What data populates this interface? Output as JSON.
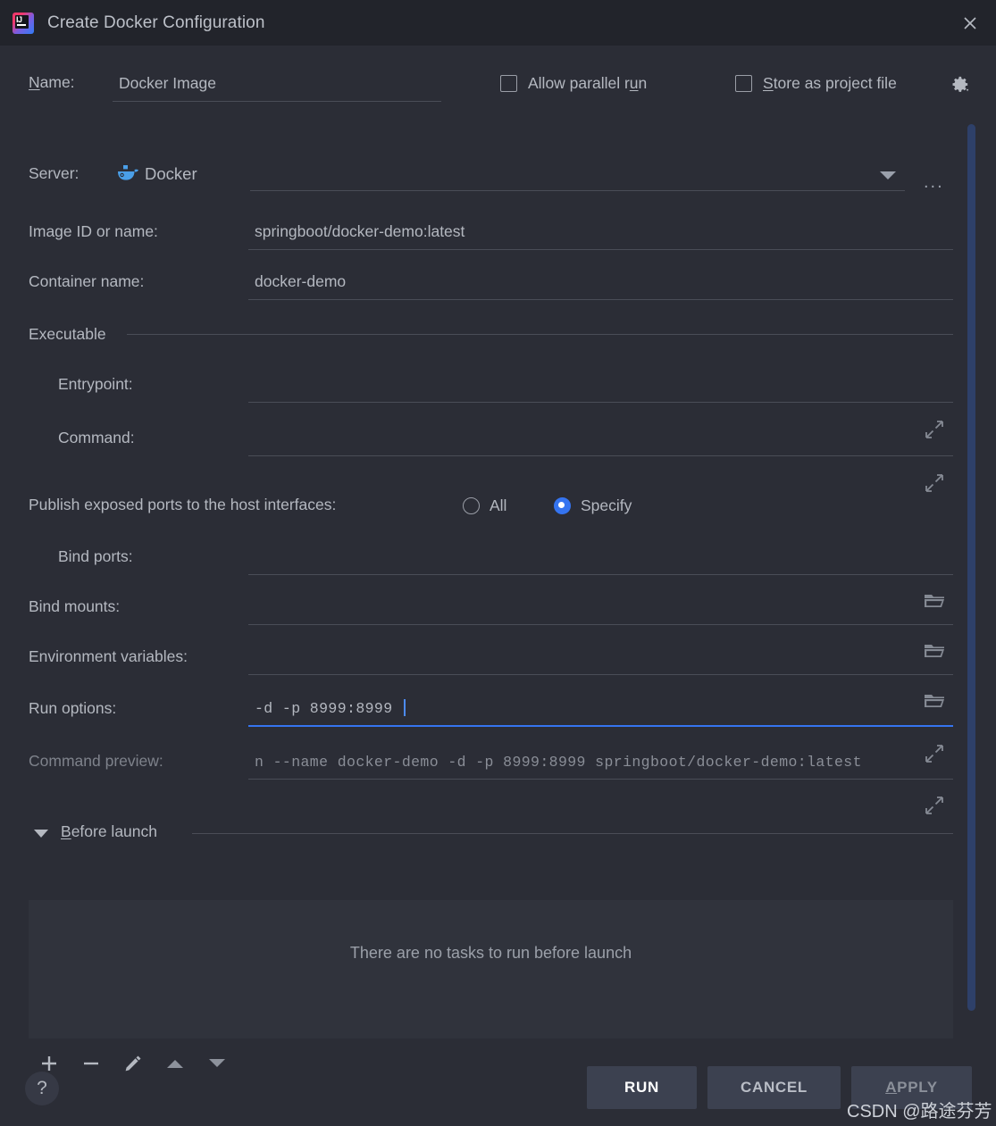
{
  "window": {
    "title": "Create Docker Configuration",
    "logo_icon": "intellij-idea-logo",
    "close_icon": "close-icon"
  },
  "header": {
    "name_label": "Name:",
    "name_value": "Docker Image",
    "allow_parallel_run_label": "Allow parallel run",
    "allow_parallel_run_checked": false,
    "store_as_project_file_label": "Store as project file",
    "store_as_project_file_checked": false,
    "settings_icon": "gear-icon"
  },
  "form": {
    "server": {
      "label": "Server:",
      "value": "Docker",
      "icon": "docker-whale-icon",
      "dropdown_icon": "chevron-down-icon",
      "more_label": "..."
    },
    "image_id": {
      "label": "Image ID or name:",
      "value": "springboot/docker-demo:latest"
    },
    "container_name": {
      "label": "Container name:",
      "value": "docker-demo"
    },
    "executable_section": {
      "label": "Executable"
    },
    "entrypoint": {
      "label": "Entrypoint:",
      "value": "",
      "expand_icon": "expand-icon"
    },
    "command": {
      "label": "Command:",
      "value": "",
      "expand_icon": "expand-icon"
    },
    "publish_ports": {
      "label": "Publish exposed ports to the host interfaces:",
      "options": [
        {
          "label": "All",
          "selected": false
        },
        {
          "label": "Specify",
          "selected": true
        }
      ]
    },
    "bind_ports": {
      "label": "Bind ports:",
      "value": "",
      "browse_icon": "folder-icon"
    },
    "bind_mounts": {
      "label": "Bind mounts:",
      "value": "",
      "browse_icon": "folder-icon"
    },
    "environment_variables": {
      "label": "Environment variables:",
      "value": "",
      "browse_icon": "folder-icon"
    },
    "run_options": {
      "label": "Run options:",
      "value": "-d -p 8999:8999",
      "focused": true,
      "expand_icon": "expand-icon"
    },
    "command_preview": {
      "label": "Command preview:",
      "value": "n --name docker-demo -d -p 8999:8999 springboot/docker-demo:latest",
      "expand_icon": "expand-icon"
    }
  },
  "before_launch": {
    "title": "Before launch",
    "collapse_icon": "chevron-down-icon",
    "empty_text": "There are no tasks to run before launch",
    "toolbar": [
      {
        "name": "add-task-button",
        "icon": "plus-icon"
      },
      {
        "name": "remove-task-button",
        "icon": "minus-icon"
      },
      {
        "name": "edit-task-button",
        "icon": "pencil-icon"
      },
      {
        "name": "move-up-button",
        "icon": "arrow-up-icon"
      },
      {
        "name": "move-down-button",
        "icon": "arrow-down-icon"
      }
    ]
  },
  "footer": {
    "help_label": "?",
    "run_label": "RUN",
    "cancel_label": "CANCEL",
    "apply_label": "APPLY"
  },
  "watermark": "CSDN @路途芬芳",
  "colors": {
    "window_bg": "#2b2d36",
    "titlebar_bg": "#22242b",
    "accent": "#3574f0",
    "docker_blue": "#4a9fe8",
    "text": "#b4b8c0",
    "field_underline": "#4a4d57",
    "panel_bg": "#30333c",
    "scrollbar": "#2e4069"
  }
}
